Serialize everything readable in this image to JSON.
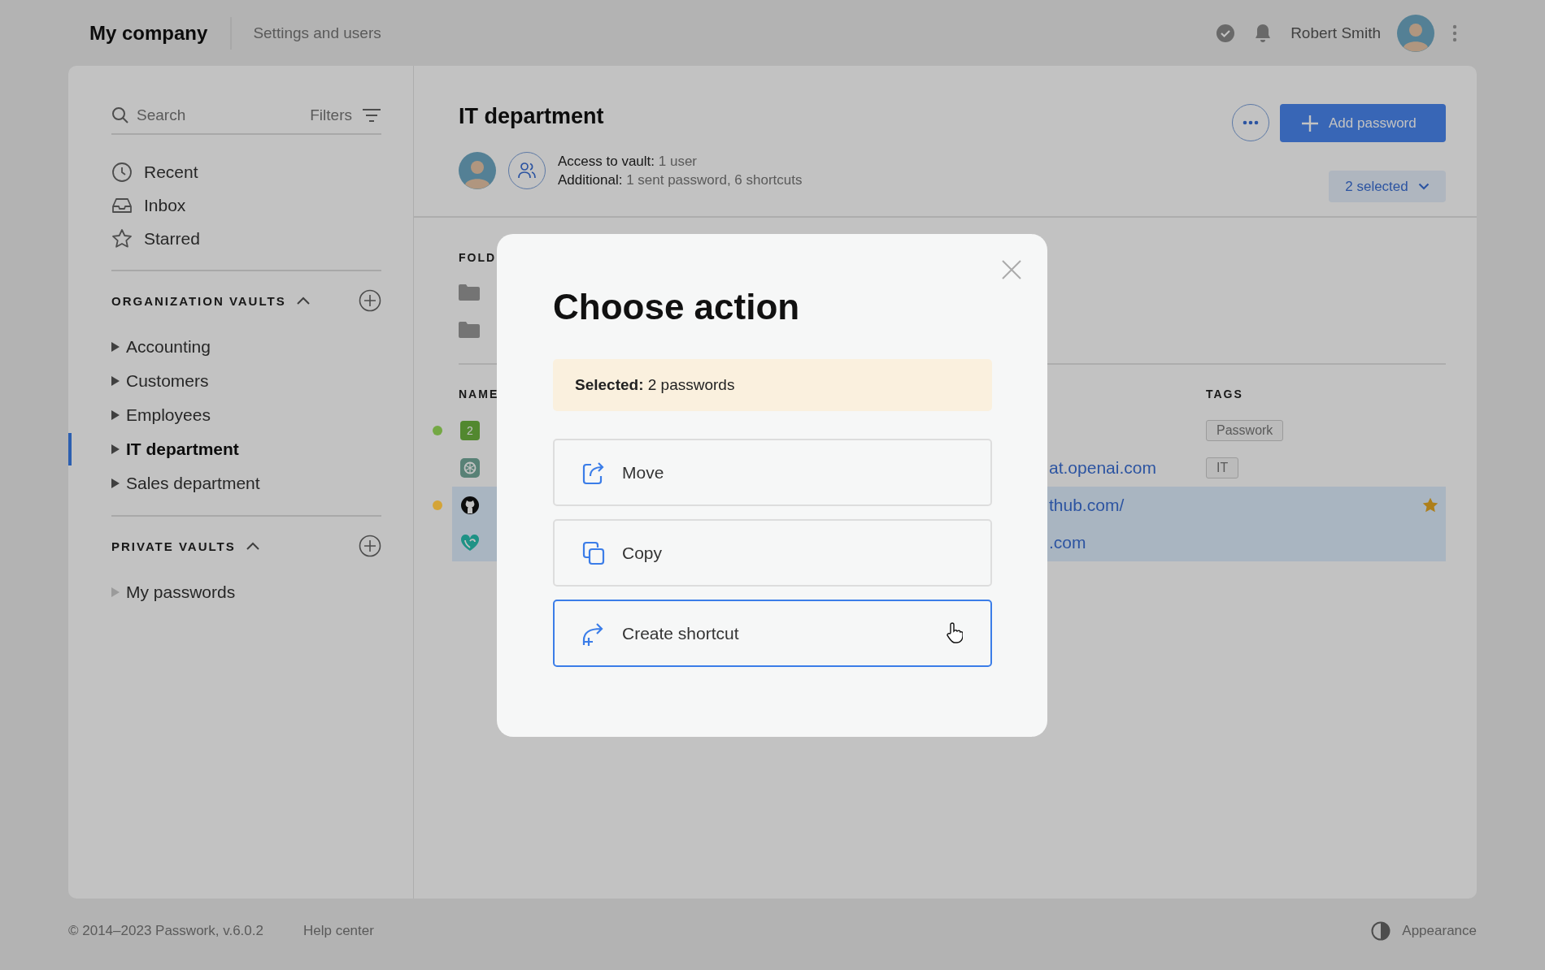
{
  "topbar": {
    "company": "My company",
    "settings_link": "Settings and users",
    "user_name": "Robert Smith",
    "sync_ok": true
  },
  "sidebar": {
    "search": {
      "placeholder": "Search"
    },
    "filters": "Filters",
    "nav": [
      {
        "kind": "recent",
        "label": "Recent"
      },
      {
        "kind": "inbox",
        "label": "Inbox"
      },
      {
        "kind": "starred",
        "label": "Starred"
      }
    ],
    "sections": [
      {
        "title": "ORGANIZATION VAULTS",
        "expanded": true,
        "items": [
          {
            "label": "Accounting",
            "selected": false,
            "expandable": true
          },
          {
            "label": "Customers",
            "selected": false,
            "expandable": true
          },
          {
            "label": "Employees",
            "selected": false,
            "expandable": true
          },
          {
            "label": "IT department",
            "selected": true,
            "expandable": true
          },
          {
            "label": "Sales department",
            "selected": false,
            "expandable": true
          }
        ]
      },
      {
        "title": "PRIVATE VAULTS",
        "expanded": true,
        "items": [
          {
            "label": "My passwords",
            "selected": false,
            "expandable": false
          }
        ]
      }
    ]
  },
  "vault": {
    "title": "IT department",
    "access_label": "Access to vault:",
    "access_value": "1 user",
    "additional_label": "Additional:",
    "additional_value": "1 sent password, 6 shortcuts",
    "add_button": "Add password",
    "selection": "2 selected"
  },
  "folders": {
    "heading": "FOLD",
    "items": [
      {
        "kind": "folder"
      },
      {
        "kind": "folder"
      }
    ]
  },
  "table": {
    "columns": [
      {
        "label": "NAME"
      },
      {
        "label": "TAGS"
      }
    ],
    "rows": [
      {
        "kind": "number",
        "badge": "2",
        "url": "",
        "tag": "Passwork",
        "color": "#74a844",
        "selected": false,
        "starred": false
      },
      {
        "kind": "knot",
        "url": "at.openai.com",
        "tag": "IT",
        "selected": false,
        "starred": false
      },
      {
        "kind": "cat",
        "url": "thub.com/",
        "tag": "",
        "color": "#d4a437",
        "selected": true,
        "starred": true
      },
      {
        "kind": "heart",
        "url": ".com",
        "tag": "",
        "selected": true,
        "starred": false
      }
    ]
  },
  "modal": {
    "title": "Choose action",
    "notice_label": "Selected:",
    "notice_value": "2 passwords",
    "actions": [
      {
        "kind": "move",
        "label": "Move",
        "selected": false
      },
      {
        "kind": "copy",
        "label": "Copy",
        "selected": false
      },
      {
        "kind": "shortcut",
        "label": "Create shortcut",
        "selected": true
      }
    ]
  },
  "footer": {
    "copyright": "© 2014–2023 Passwork, v.6.0.2",
    "help": "Help center",
    "appearance": "Appearance"
  }
}
